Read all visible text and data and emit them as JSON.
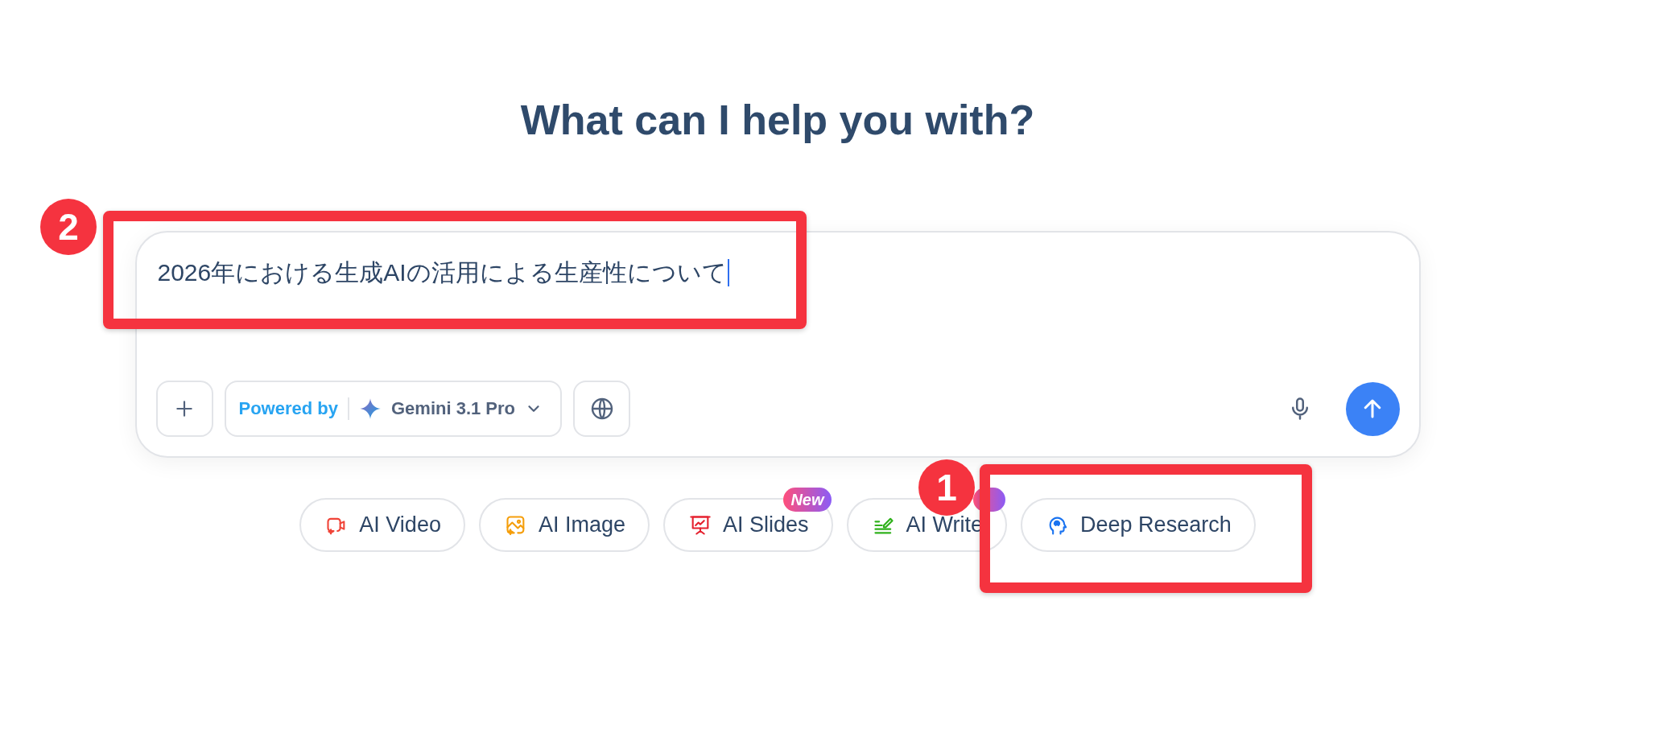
{
  "heading": "What can I help you with?",
  "prompt": {
    "value": "2026年における生成AIの活用による生産性について",
    "focused": true,
    "model_selector": {
      "prefix": "Powered by",
      "model": "Gemini 3.1 Pro"
    }
  },
  "chips": [
    {
      "kind": "video",
      "label": "AI Video"
    },
    {
      "kind": "image",
      "label": "AI Image"
    },
    {
      "kind": "slides",
      "label": "AI Slides",
      "badge": "New"
    },
    {
      "kind": "write",
      "label": "AI Write",
      "covered_badge": true
    },
    {
      "kind": "research",
      "label": "Deep Research"
    }
  ],
  "annotations": [
    {
      "number": "2"
    },
    {
      "number": "1"
    }
  ]
}
